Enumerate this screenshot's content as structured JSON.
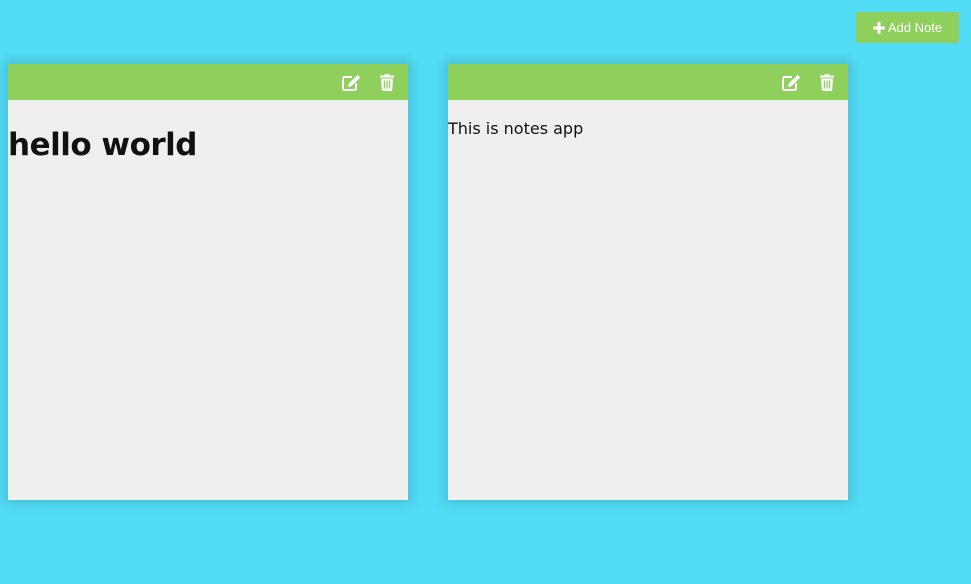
{
  "toolbar": {
    "add_note_label": "Add Note",
    "add_icon": "plus-icon"
  },
  "colors": {
    "background": "#52dcf5",
    "accent_green": "#8fcf5b",
    "note_background": "#efefef"
  },
  "notes": [
    {
      "content": "hello world",
      "format": "heading",
      "edit_icon": "edit-icon",
      "delete_icon": "trash-icon"
    },
    {
      "content": "This is notes app",
      "format": "paragraph",
      "edit_icon": "edit-icon",
      "delete_icon": "trash-icon"
    }
  ]
}
